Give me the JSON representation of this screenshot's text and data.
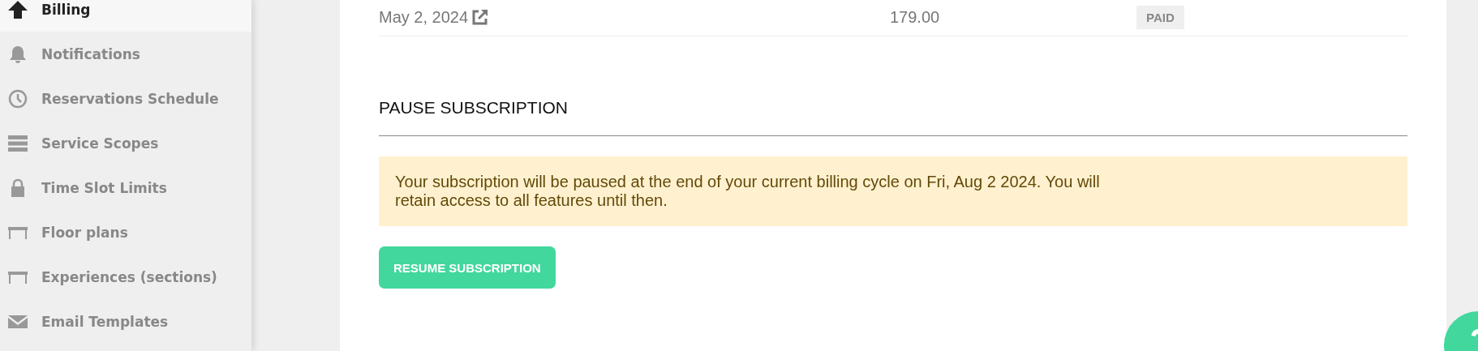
{
  "sidebar": {
    "items": [
      {
        "label": "Billing",
        "kind": "arrow-up",
        "selected": true
      },
      {
        "label": "Notifications",
        "kind": "bell",
        "selected": false
      },
      {
        "label": "Reservations Schedule",
        "kind": "clock",
        "selected": false
      },
      {
        "label": "Service Scopes",
        "kind": "bars",
        "selected": false
      },
      {
        "label": "Time Slot Limits",
        "kind": "lock",
        "selected": false
      },
      {
        "label": "Floor plans",
        "kind": "table",
        "selected": false
      },
      {
        "label": "Experiences (sections)",
        "kind": "table",
        "selected": false
      },
      {
        "label": "Email Templates",
        "kind": "envelope",
        "selected": false
      }
    ]
  },
  "invoices": {
    "rows": [
      {
        "date": "May 2, 2024",
        "amount": "179.00",
        "status": "PAID"
      }
    ]
  },
  "pause_subscription": {
    "heading": "PAUSE SUBSCRIPTION",
    "notice": "Your subscription will be paused at the end of your current billing cycle on Fri, Aug 2 2024. You will retain access to all features until then.",
    "button": "RESUME SUBSCRIPTION"
  }
}
